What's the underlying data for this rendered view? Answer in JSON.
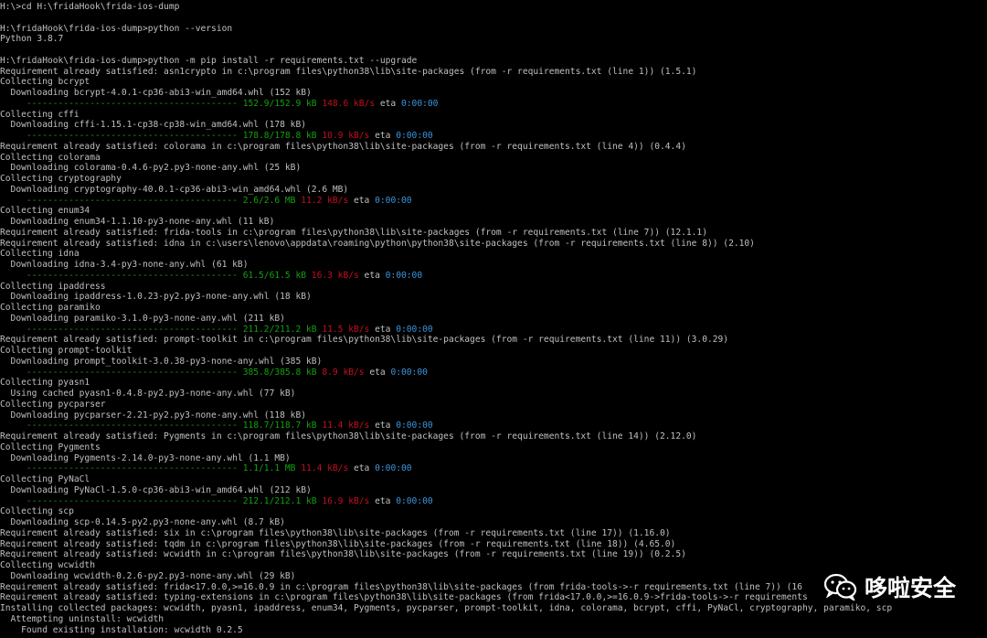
{
  "terminal": {
    "lines": [
      [
        {
          "t": "H:\\>cd H:\\fridaHook\\frida-ios-dump",
          "c": "white"
        }
      ],
      [
        {
          "t": "",
          "c": "white"
        }
      ],
      [
        {
          "t": "H:\\fridaHook\\frida-ios-dump>python --version",
          "c": "white"
        }
      ],
      [
        {
          "t": "Python 3.8.7",
          "c": "white"
        }
      ],
      [
        {
          "t": "",
          "c": "white"
        }
      ],
      [
        {
          "t": "H:\\fridaHook\\frida-ios-dump>python -m pip install -r requirements.txt --upgrade",
          "c": "white"
        }
      ],
      [
        {
          "t": "Requirement already satisfied: asn1crypto in c:\\program files\\python38\\lib\\site-packages (from -r requirements.txt (line 1)) (1.5.1)",
          "c": "white"
        }
      ],
      [
        {
          "t": "Collecting bcrypt",
          "c": "white"
        }
      ],
      [
        {
          "t": "  Downloading bcrypt-4.0.1-cp36-abi3-win_amd64.whl (152 kB)",
          "c": "white"
        }
      ],
      [
        {
          "t": "     ---------------------------------------- ",
          "c": "green"
        },
        {
          "t": "152.9/152.9 kB ",
          "c": "green"
        },
        {
          "t": "148.6 kB/s",
          "c": "red"
        },
        {
          "t": " eta ",
          "c": "white"
        },
        {
          "t": "0:00:00",
          "c": "cyan"
        }
      ],
      [
        {
          "t": "Collecting cffi",
          "c": "white"
        }
      ],
      [
        {
          "t": "  Downloading cffi-1.15.1-cp38-cp38-win_amd64.whl (178 kB)",
          "c": "white"
        }
      ],
      [
        {
          "t": "     ---------------------------------------- ",
          "c": "green"
        },
        {
          "t": "178.8/178.8 kB ",
          "c": "green"
        },
        {
          "t": "10.9 kB/s",
          "c": "red"
        },
        {
          "t": " eta ",
          "c": "white"
        },
        {
          "t": "0:00:00",
          "c": "cyan"
        }
      ],
      [
        {
          "t": "Requirement already satisfied: colorama in c:\\program files\\python38\\lib\\site-packages (from -r requirements.txt (line 4)) (0.4.4)",
          "c": "white"
        }
      ],
      [
        {
          "t": "Collecting colorama",
          "c": "white"
        }
      ],
      [
        {
          "t": "  Downloading colorama-0.4.6-py2.py3-none-any.whl (25 kB)",
          "c": "white"
        }
      ],
      [
        {
          "t": "Collecting cryptography",
          "c": "white"
        }
      ],
      [
        {
          "t": "  Downloading cryptography-40.0.1-cp36-abi3-win_amd64.whl (2.6 MB)",
          "c": "white"
        }
      ],
      [
        {
          "t": "     ---------------------------------------- ",
          "c": "green"
        },
        {
          "t": "2.6/2.6 MB ",
          "c": "green"
        },
        {
          "t": "11.2 kB/s",
          "c": "red"
        },
        {
          "t": " eta ",
          "c": "white"
        },
        {
          "t": "0:00:00",
          "c": "cyan"
        }
      ],
      [
        {
          "t": "Collecting enum34",
          "c": "white"
        }
      ],
      [
        {
          "t": "  Downloading enum34-1.1.10-py3-none-any.whl (11 kB)",
          "c": "white"
        }
      ],
      [
        {
          "t": "Requirement already satisfied: frida-tools in c:\\program files\\python38\\lib\\site-packages (from -r requirements.txt (line 7)) (12.1.1)",
          "c": "white"
        }
      ],
      [
        {
          "t": "Requirement already satisfied: idna in c:\\users\\lenovo\\appdata\\roaming\\python\\python38\\site-packages (from -r requirements.txt (line 8)) (2.10)",
          "c": "white"
        }
      ],
      [
        {
          "t": "Collecting idna",
          "c": "white"
        }
      ],
      [
        {
          "t": "  Downloading idna-3.4-py3-none-any.whl (61 kB)",
          "c": "white"
        }
      ],
      [
        {
          "t": "     ---------------------------------------- ",
          "c": "green"
        },
        {
          "t": "61.5/61.5 kB ",
          "c": "green"
        },
        {
          "t": "16.3 kB/s",
          "c": "red"
        },
        {
          "t": " eta ",
          "c": "white"
        },
        {
          "t": "0:00:00",
          "c": "cyan"
        }
      ],
      [
        {
          "t": "Collecting ipaddress",
          "c": "white"
        }
      ],
      [
        {
          "t": "  Downloading ipaddress-1.0.23-py2.py3-none-any.whl (18 kB)",
          "c": "white"
        }
      ],
      [
        {
          "t": "Collecting paramiko",
          "c": "white"
        }
      ],
      [
        {
          "t": "  Downloading paramiko-3.1.0-py3-none-any.whl (211 kB)",
          "c": "white"
        }
      ],
      [
        {
          "t": "     ---------------------------------------- ",
          "c": "green"
        },
        {
          "t": "211.2/211.2 kB ",
          "c": "green"
        },
        {
          "t": "11.5 kB/s",
          "c": "red"
        },
        {
          "t": " eta ",
          "c": "white"
        },
        {
          "t": "0:00:00",
          "c": "cyan"
        }
      ],
      [
        {
          "t": "Requirement already satisfied: prompt-toolkit in c:\\program files\\python38\\lib\\site-packages (from -r requirements.txt (line 11)) (3.0.29)",
          "c": "white"
        }
      ],
      [
        {
          "t": "Collecting prompt-toolkit",
          "c": "white"
        }
      ],
      [
        {
          "t": "  Downloading prompt_toolkit-3.0.38-py3-none-any.whl (385 kB)",
          "c": "white"
        }
      ],
      [
        {
          "t": "     ---------------------------------------- ",
          "c": "green"
        },
        {
          "t": "385.8/385.8 kB ",
          "c": "green"
        },
        {
          "t": "8.9 kB/s",
          "c": "red"
        },
        {
          "t": " eta ",
          "c": "white"
        },
        {
          "t": "0:00:00",
          "c": "cyan"
        }
      ],
      [
        {
          "t": "Collecting pyasn1",
          "c": "white"
        }
      ],
      [
        {
          "t": "  Using cached pyasn1-0.4.8-py2.py3-none-any.whl (77 kB)",
          "c": "white"
        }
      ],
      [
        {
          "t": "Collecting pycparser",
          "c": "white"
        }
      ],
      [
        {
          "t": "  Downloading pycparser-2.21-py2.py3-none-any.whl (118 kB)",
          "c": "white"
        }
      ],
      [
        {
          "t": "     ---------------------------------------- ",
          "c": "green"
        },
        {
          "t": "118.7/118.7 kB ",
          "c": "green"
        },
        {
          "t": "11.4 kB/s",
          "c": "red"
        },
        {
          "t": " eta ",
          "c": "white"
        },
        {
          "t": "0:00:00",
          "c": "cyan"
        }
      ],
      [
        {
          "t": "Requirement already satisfied: Pygments in c:\\program files\\python38\\lib\\site-packages (from -r requirements.txt (line 14)) (2.12.0)",
          "c": "white"
        }
      ],
      [
        {
          "t": "Collecting Pygments",
          "c": "white"
        }
      ],
      [
        {
          "t": "  Downloading Pygments-2.14.0-py3-none-any.whl (1.1 MB)",
          "c": "white"
        }
      ],
      [
        {
          "t": "     ---------------------------------------- ",
          "c": "green"
        },
        {
          "t": "1.1/1.1 MB ",
          "c": "green"
        },
        {
          "t": "11.4 kB/s",
          "c": "red"
        },
        {
          "t": " eta ",
          "c": "white"
        },
        {
          "t": "0:00:00",
          "c": "cyan"
        }
      ],
      [
        {
          "t": "Collecting PyNaCl",
          "c": "white"
        }
      ],
      [
        {
          "t": "  Downloading PyNaCl-1.5.0-cp36-abi3-win_amd64.whl (212 kB)",
          "c": "white"
        }
      ],
      [
        {
          "t": "     ---------------------------------------- ",
          "c": "green"
        },
        {
          "t": "212.1/212.1 kB ",
          "c": "green"
        },
        {
          "t": "16.9 kB/s",
          "c": "red"
        },
        {
          "t": " eta ",
          "c": "white"
        },
        {
          "t": "0:00:00",
          "c": "cyan"
        }
      ],
      [
        {
          "t": "Collecting scp",
          "c": "white"
        }
      ],
      [
        {
          "t": "  Downloading scp-0.14.5-py2.py3-none-any.whl (8.7 kB)",
          "c": "white"
        }
      ],
      [
        {
          "t": "Requirement already satisfied: six in c:\\program files\\python38\\lib\\site-packages (from -r requirements.txt (line 17)) (1.16.0)",
          "c": "white"
        }
      ],
      [
        {
          "t": "Requirement already satisfied: tqdm in c:\\program files\\python38\\lib\\site-packages (from -r requirements.txt (line 18)) (4.65.0)",
          "c": "white"
        }
      ],
      [
        {
          "t": "Requirement already satisfied: wcwidth in c:\\program files\\python38\\lib\\site-packages (from -r requirements.txt (line 19)) (0.2.5)",
          "c": "white"
        }
      ],
      [
        {
          "t": "Collecting wcwidth",
          "c": "white"
        }
      ],
      [
        {
          "t": "  Downloading wcwidth-0.2.6-py2.py3-none-any.whl (29 kB)",
          "c": "white"
        }
      ],
      [
        {
          "t": "Requirement already satisfied: frida<17.0.0,>=16.0.9 in c:\\program files\\python38\\lib\\site-packages (from frida-tools->-r requirements.txt (line 7)) (16",
          "c": "white"
        }
      ],
      [
        {
          "t": "Requirement already satisfied: typing-extensions in c:\\program files\\python38\\lib\\site-packages (from frida<17.0.0,>=16.0.9->frida-tools->-r requirements",
          "c": "white"
        }
      ],
      [
        {
          "t": "Installing collected packages: wcwidth, pyasn1, ipaddress, enum34, Pygments, pycparser, prompt-toolkit, idna, colorama, bcrypt, cffi, PyNaCl, cryptography, paramiko, scp",
          "c": "white"
        }
      ],
      [
        {
          "t": "  Attempting uninstall: wcwidth",
          "c": "white"
        }
      ],
      [
        {
          "t": "    Found existing installation: wcwidth 0.2.5",
          "c": "white"
        }
      ]
    ]
  },
  "watermark": {
    "text": "哆啦安全",
    "icon": "wechat-icon"
  },
  "colors": {
    "background": "#000000",
    "text": "#c0c0c0",
    "green": "#13a10e",
    "red": "#c50f1f",
    "cyan": "#3a96dd"
  }
}
